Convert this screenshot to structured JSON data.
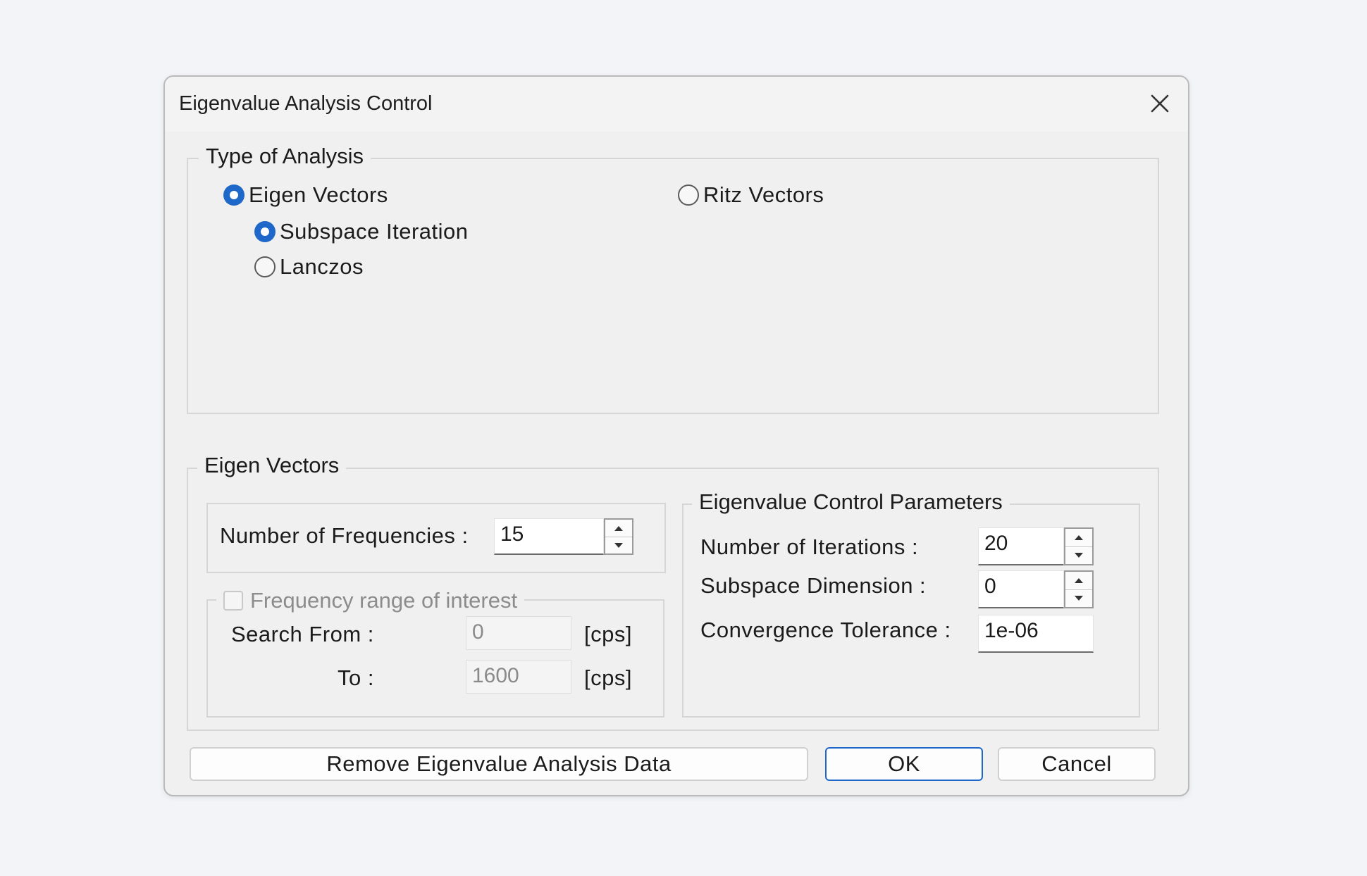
{
  "dialog": {
    "title": "Eigenvalue Analysis Control",
    "close_icon": "close-icon"
  },
  "type_of_analysis": {
    "legend": "Type of Analysis",
    "eigen_vectors_label": "Eigen Vectors",
    "eigen_vectors_selected": true,
    "ritz_vectors_label": "Ritz Vectors",
    "ritz_vectors_selected": false,
    "subspace_iteration_label": "Subspace Iteration",
    "subspace_iteration_selected": true,
    "lanczos_label": "Lanczos",
    "lanczos_selected": false
  },
  "eigen_vectors": {
    "legend": "Eigen Vectors",
    "num_frequencies_label": "Number of Frequencies :",
    "num_frequencies_value": "15",
    "frequency_range": {
      "label": "Frequency range of interest",
      "checked": false,
      "search_from_label": "Search From :",
      "search_from_value": "0",
      "to_label": "To :",
      "to_value": "1600",
      "unit_from": "[cps]",
      "unit_to": "[cps]"
    }
  },
  "control_params": {
    "legend": "Eigenvalue Control Parameters",
    "iterations_label": "Number of Iterations :",
    "iterations_value": "20",
    "subspace_dim_label": "Subspace Dimension :",
    "subspace_dim_value": "0",
    "tolerance_label": "Convergence Tolerance :",
    "tolerance_value": "1e-06"
  },
  "buttons": {
    "remove_label": "Remove Eigenvalue Analysis Data",
    "ok_label": "OK",
    "cancel_label": "Cancel"
  },
  "colors": {
    "accent": "#1d68c8",
    "dialog_bg": "#f0f0f0",
    "page_bg": "#f3f4f8"
  }
}
